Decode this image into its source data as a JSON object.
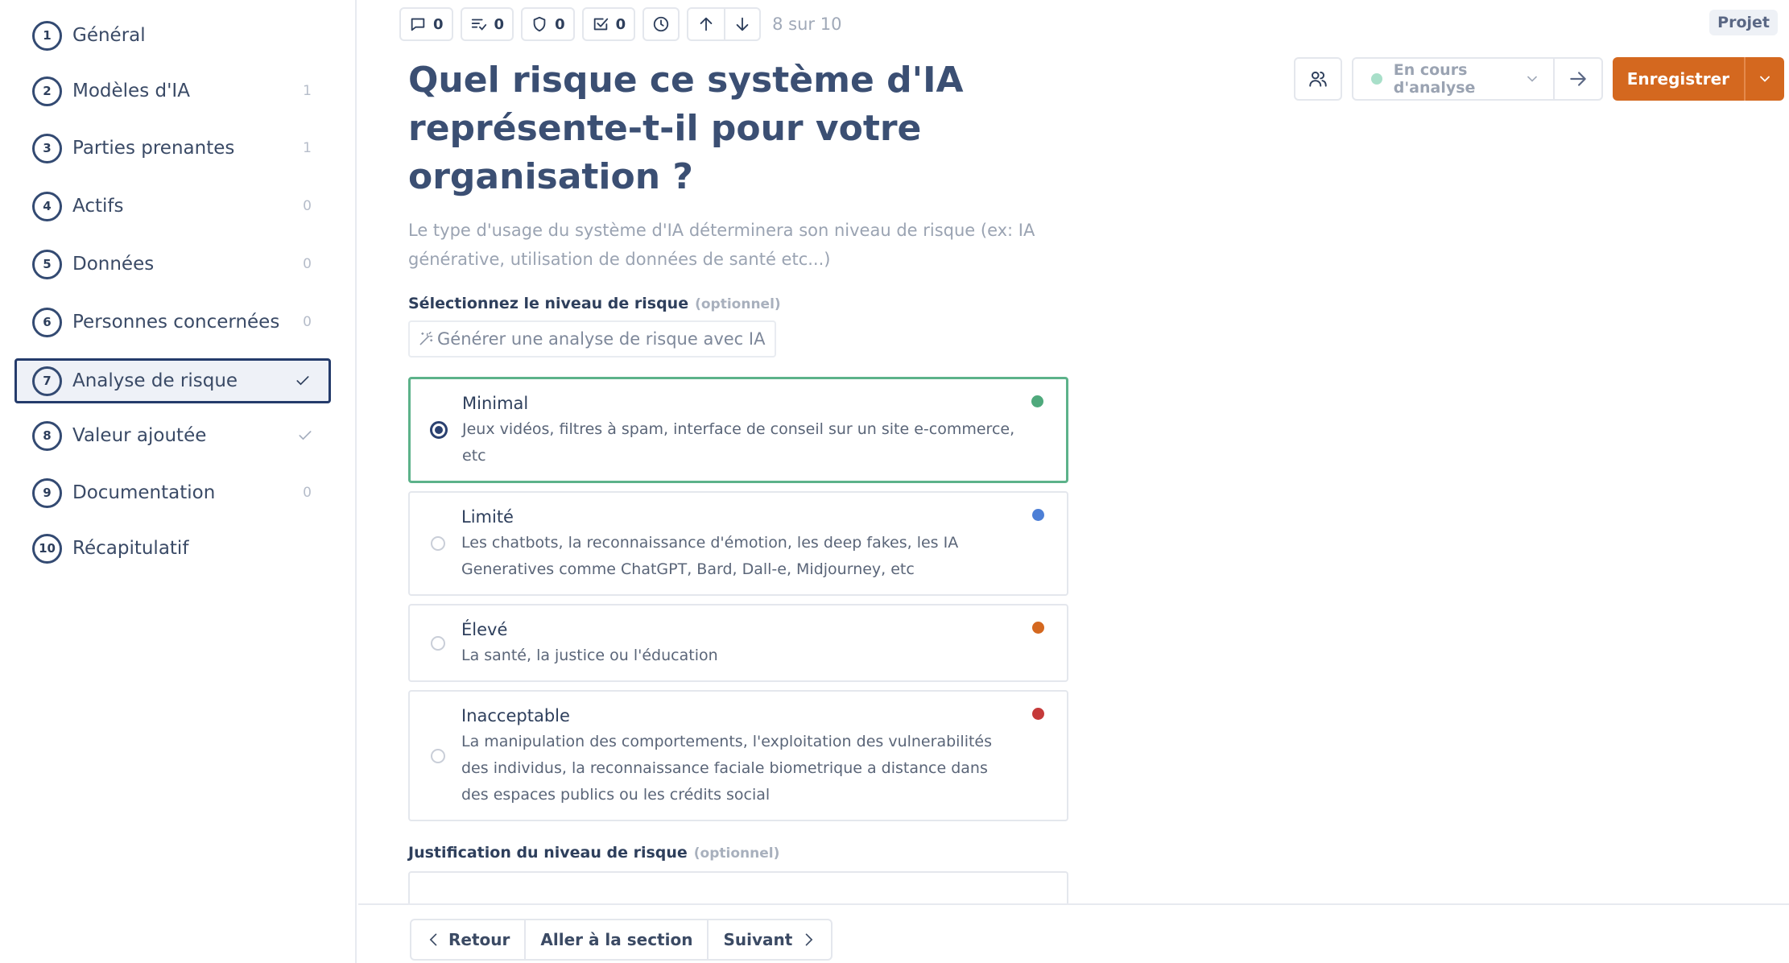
{
  "sidebar": {
    "items": [
      {
        "num": "1",
        "label": "Général",
        "count": "",
        "check": false,
        "active": false
      },
      {
        "num": "2",
        "label": "Modèles d'IA",
        "count": "1",
        "check": false,
        "active": false
      },
      {
        "num": "3",
        "label": "Parties prenantes",
        "count": "1",
        "check": false,
        "active": false
      },
      {
        "num": "4",
        "label": "Actifs",
        "count": "0",
        "check": false,
        "active": false
      },
      {
        "num": "5",
        "label": "Données",
        "count": "0",
        "check": false,
        "active": false
      },
      {
        "num": "6",
        "label": "Personnes concernées",
        "count": "0",
        "check": false,
        "active": false
      },
      {
        "num": "7",
        "label": "Analyse de risque",
        "count": "",
        "check": true,
        "active": true
      },
      {
        "num": "8",
        "label": "Valeur ajoutée",
        "count": "",
        "check": true,
        "active": false
      },
      {
        "num": "9",
        "label": "Documentation",
        "count": "0",
        "check": false,
        "active": false
      },
      {
        "num": "10",
        "label": "Récapitulatif",
        "count": "",
        "check": false,
        "active": false
      }
    ]
  },
  "toolbar": {
    "comments_count": "0",
    "tasks_count": "0",
    "controls_count": "0",
    "checks_count": "0",
    "position_text": "8 sur 10"
  },
  "header": {
    "project_badge": "Projet",
    "status_label": "En cours d'analyse",
    "save_label": "Enregistrer"
  },
  "question": {
    "title": "Quel risque ce système d'IA représente-t-il pour votre organisation ?",
    "description": "Le type d'usage du système d'IA déterminera son niveau de risque (ex: IA générative, utilisation de données de santé etc...)",
    "risk_label": "Sélectionnez le niveau de risque",
    "optional_tag": "(optionnel)",
    "ai_button": "Générer une analyse de risque avec IA",
    "options": [
      {
        "title": "Minimal",
        "desc": "Jeux vidéos, filtres à spam, interface de conseil sur un site e-commerce, etc",
        "color": "#4fa97c",
        "selected": true
      },
      {
        "title": "Limité",
        "desc": "Les chatbots, la reconnaissance d'émotion, les deep fakes, les IA Generatives comme ChatGPT, Bard, Dall-e, Midjourney, etc",
        "color": "#4d7fd6",
        "selected": false
      },
      {
        "title": "Élevé",
        "desc": "La santé, la justice ou l'éducation",
        "color": "#d4681f",
        "selected": false
      },
      {
        "title": "Inacceptable",
        "desc": "La manipulation des comportements, l'exploitation des vulnerabilités des individus, la reconnaissance faciale biometrique a distance dans des espaces publics ou les crédits social",
        "color": "#c53a3a",
        "selected": false
      }
    ],
    "justification_label": "Justification du niveau de risque",
    "justification_optional": "(optionnel)"
  },
  "footer": {
    "back_label": "Retour",
    "goto_label": "Aller à la section",
    "next_label": "Suivant"
  },
  "colors": {
    "accent": "#d4681f",
    "primary": "#243b6b",
    "selected_border": "#5cb28a"
  }
}
